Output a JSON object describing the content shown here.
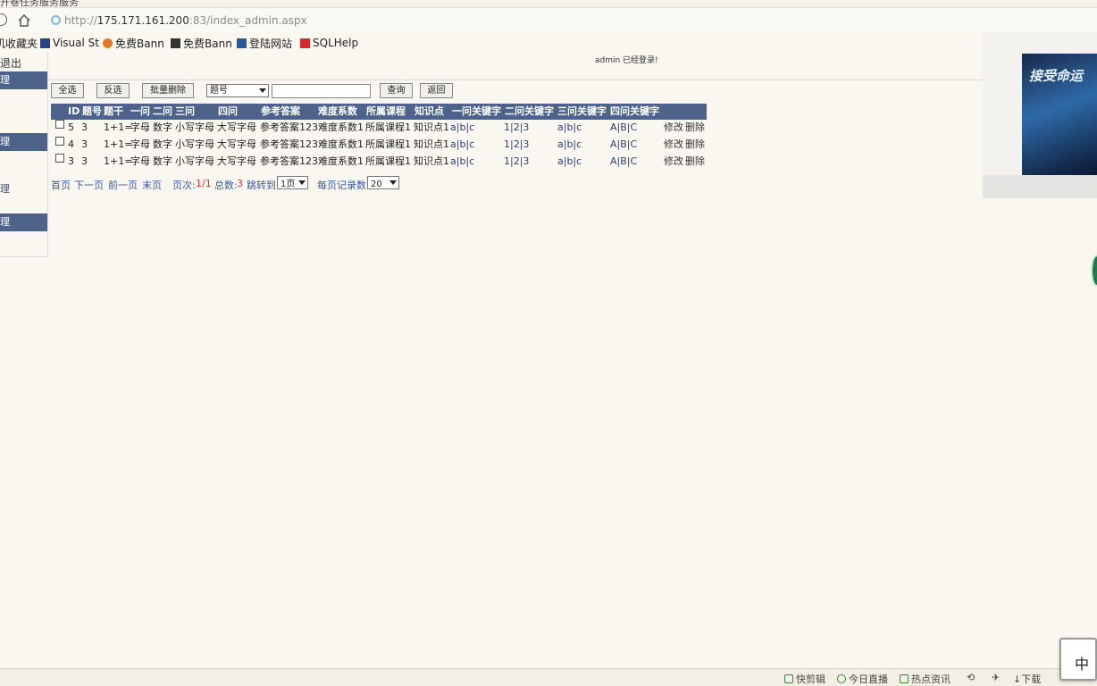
{
  "browser": {
    "tab_label": "开卷任务服务服务",
    "url_prefix": "http://",
    "url_host": "175.171.161.200",
    "url_suffix": ":83/index_admin.aspx"
  },
  "bookmarks": [
    {
      "label": "机收藏夹"
    },
    {
      "label": "Visual St"
    },
    {
      "label": "免费Bann"
    },
    {
      "label": "免费Bann"
    },
    {
      "label": "登陆网站"
    },
    {
      "label": "SQLHelp"
    }
  ],
  "sidebar": {
    "logout": "退出",
    "sections": [
      {
        "label": "理"
      },
      {
        "label": "理"
      },
      {
        "label": "理"
      },
      {
        "label": "理"
      }
    ]
  },
  "header": {
    "login_status": "admin 已经登录!"
  },
  "toolbar": {
    "select_all": "全选",
    "invert": "反选",
    "batch_delete": "批量删除",
    "field_select": "题号",
    "search_value": "",
    "query": "查询",
    "back": "返回"
  },
  "table": {
    "columns": [
      "ID",
      "题号",
      "题干",
      "一问",
      "二问",
      "三问",
      "四问",
      "参考答案",
      "难度系数",
      "所属课程",
      "知识点",
      "一问关键字",
      "二问关键字",
      "三问关键字",
      "四问关键字"
    ],
    "rows": [
      {
        "id": "5",
        "num": "3",
        "stem": "1+1=",
        "q1": "字母",
        "q2": "数字",
        "q3": "小写字母",
        "q4": "大写字母",
        "answer": "参考答案123",
        "difficulty": "难度系数1",
        "course": "所属课程1",
        "point": "知识点1",
        "k1": "a|b|c",
        "k2": "1|2|3",
        "k3": "a|b|c",
        "k4": "A|B|C",
        "edit": "修改",
        "del": "删除"
      },
      {
        "id": "4",
        "num": "3",
        "stem": "1+1=",
        "q1": "字母",
        "q2": "数字",
        "q3": "小写字母",
        "q4": "大写字母",
        "answer": "参考答案123",
        "difficulty": "难度系数1",
        "course": "所属课程1",
        "point": "知识点1",
        "k1": "a|b|c",
        "k2": "1|2|3",
        "k3": "a|b|c",
        "k4": "A|B|C",
        "edit": "修改",
        "del": "删除"
      },
      {
        "id": "3",
        "num": "3",
        "stem": "1+1=",
        "q1": "字母",
        "q2": "数字",
        "q3": "小写字母",
        "q4": "大写字母",
        "answer": "参考答案123",
        "difficulty": "难度系数1",
        "course": "所属课程1",
        "point": "知识点1",
        "k1": "a|b|c",
        "k2": "1|2|3",
        "k3": "a|b|c",
        "k4": "A|B|C",
        "edit": "修改",
        "del": "删除"
      }
    ]
  },
  "pager": {
    "first": "首页",
    "next": "下一页",
    "prev": "前一页",
    "last": "末页",
    "page_label": "页次:",
    "page_value": "1/1",
    "total_label": "总数:",
    "total_value": "3",
    "jump_label": "跳转到",
    "jump_value": "1页",
    "per_page_label": "每页记录数",
    "per_page_value": "20"
  },
  "ad": {
    "title": "接受命运"
  },
  "statusbar": {
    "items": [
      "快剪辑",
      "今日直播",
      "热点资讯",
      "下载"
    ]
  },
  "ime": {
    "label": "中"
  }
}
